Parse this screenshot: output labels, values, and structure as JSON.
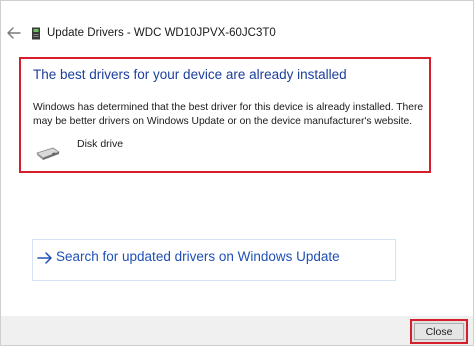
{
  "window": {
    "title": "Update Drivers - WDC WD10JPVX-60JC3T0"
  },
  "result": {
    "heading": "The best drivers for your device are already installed",
    "description": "Windows has determined that the best driver for this device is already installed. There may be better drivers on Windows Update or on the device manufacturer's website.",
    "device_name": "Disk drive"
  },
  "actions": {
    "windows_update_link": "Search for updated drivers on Windows Update",
    "close_label": "Close"
  },
  "icons": {
    "back": "back-arrow-icon",
    "title": "device-icon",
    "device": "disk-drive-icon",
    "link": "right-arrow-icon"
  },
  "colors": {
    "heading": "#1c3f9c",
    "link": "#1f50b8",
    "highlight_border": "#d61f2c",
    "footer": "#f0f0f0"
  }
}
